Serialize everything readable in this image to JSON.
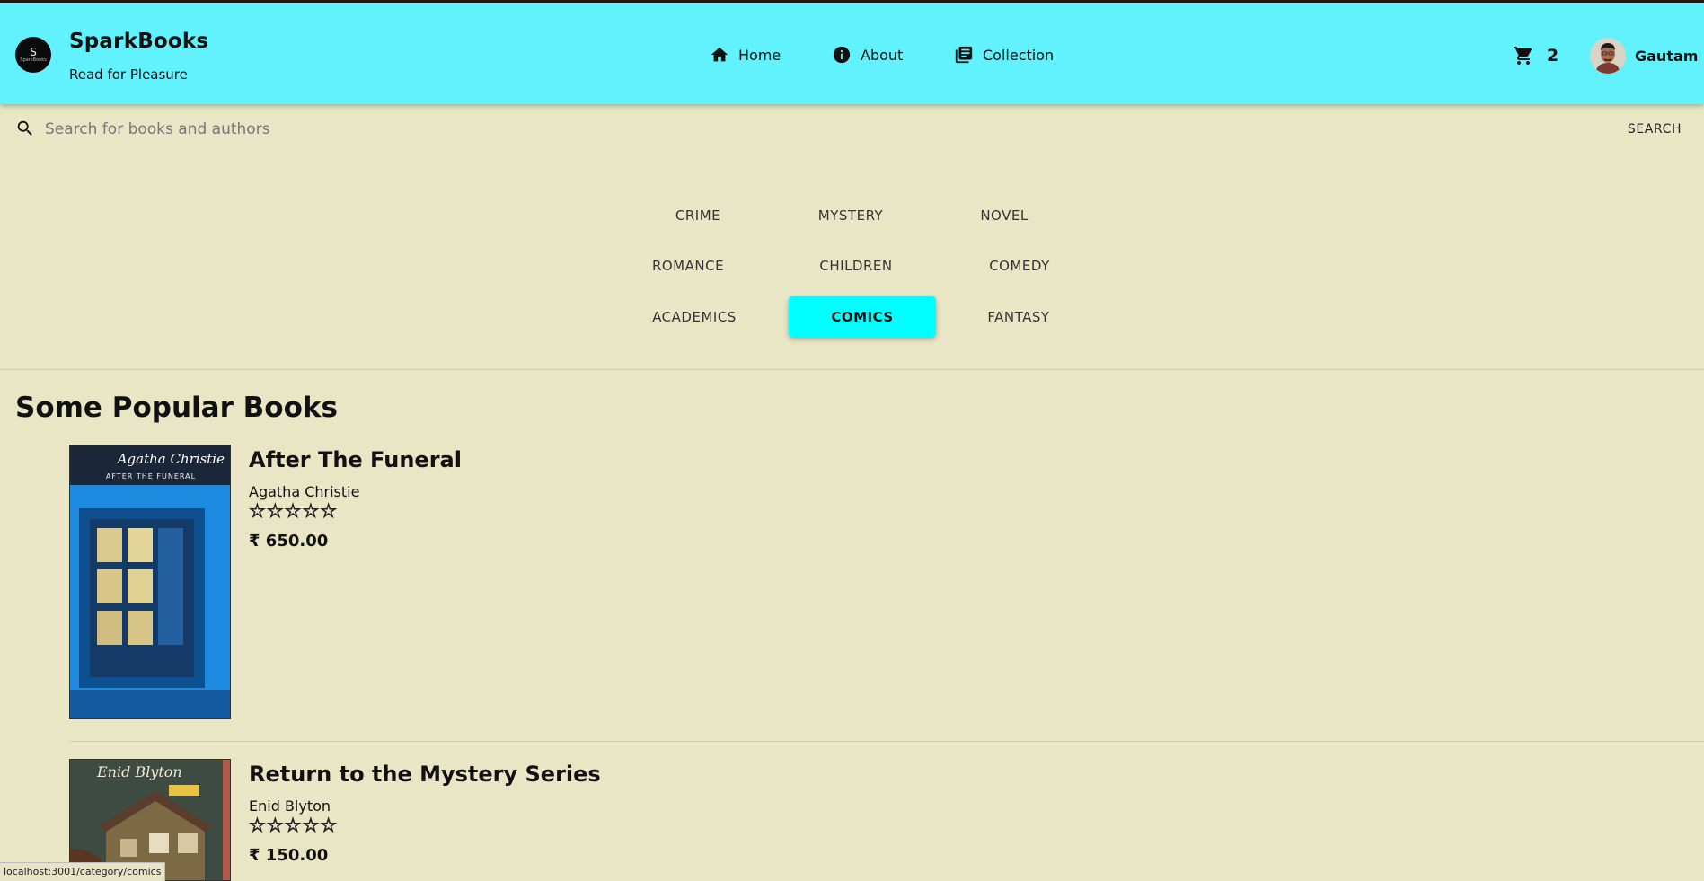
{
  "brand": {
    "logo_letter": "S",
    "logo_text": "SparkBooks",
    "title": "SparkBooks",
    "tagline": "Read for Pleasure"
  },
  "nav": [
    {
      "label": "Home",
      "icon": "home-icon"
    },
    {
      "label": "About",
      "icon": "info-icon"
    },
    {
      "label": "Collection",
      "icon": "library-books-icon"
    }
  ],
  "cart": {
    "count": "2",
    "icon": "cart-icon"
  },
  "user": {
    "name": "Gautam"
  },
  "search": {
    "placeholder": "Search for books and authors",
    "value": "",
    "button_label": "SEARCH"
  },
  "categories": [
    {
      "label": "CRIME",
      "active": false
    },
    {
      "label": "MYSTERY",
      "active": false
    },
    {
      "label": "NOVEL",
      "active": false
    },
    {
      "label": "ROMANCE",
      "active": false
    },
    {
      "label": "CHILDREN",
      "active": false
    },
    {
      "label": "COMEDY",
      "active": false
    },
    {
      "label": "ACADEMICS",
      "active": false
    },
    {
      "label": "COMICS",
      "active": true
    },
    {
      "label": "FANTASY",
      "active": false
    }
  ],
  "section_title": "Some Popular Books",
  "books": [
    {
      "title": "After The Funeral",
      "author": "Agatha Christie",
      "rating": 5,
      "stars": "☆☆☆☆☆",
      "price": "₹ 650.00",
      "cover_text_top": "Agatha Christie",
      "cover_text_sub": "AFTER THE FUNERAL"
    },
    {
      "title": "Return to the Mystery Series",
      "author": "Enid Blyton",
      "rating": 5,
      "stars": "☆☆☆☆☆",
      "price": "₹ 150.00",
      "cover_text_top": "Enid Blyton"
    }
  ],
  "status_url": "localhost:3001/category/comics",
  "colors": {
    "header": "#62f2fd",
    "background": "#e9e6c6",
    "active_category": "#00ffff",
    "star": "#f3c132"
  }
}
